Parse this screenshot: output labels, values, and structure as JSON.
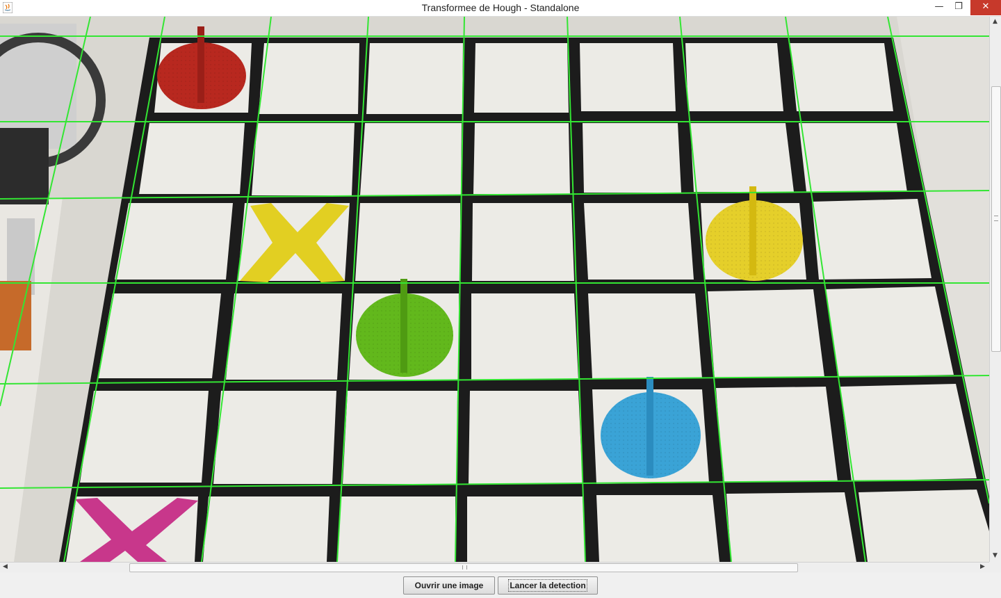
{
  "window": {
    "title": "Transformee de Hough - Standalone",
    "icon": "java-icon",
    "controls": {
      "minimize": "—",
      "maximize": "❐",
      "close": "✕"
    }
  },
  "image": {
    "description_icon": "board-photo",
    "line_color": "#33e633",
    "board_color": "#ecebe6",
    "border_color": "#1a1a1a"
  },
  "scrollbars": {
    "left_arrow": "◀",
    "right_arrow": "▶",
    "up_arrow": "▲",
    "down_arrow": "▼"
  },
  "buttons": {
    "open_label": "Ouvrir une image",
    "detect_label": "Lancer la detection"
  }
}
